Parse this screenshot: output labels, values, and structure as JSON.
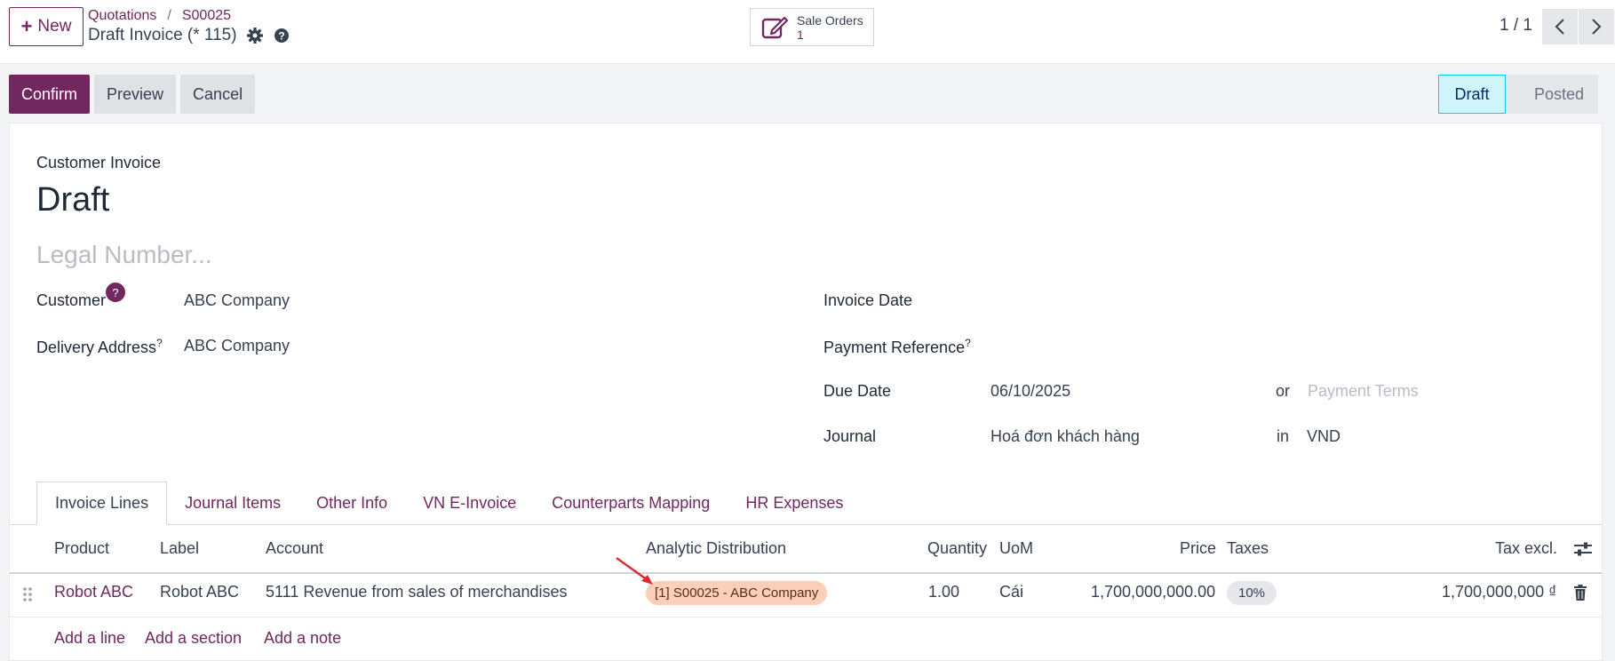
{
  "topbar": {
    "new_label": "New",
    "breadcrumb": [
      "Quotations",
      "S00025"
    ],
    "breadcrumb_sep": "/",
    "record_title": "Draft Invoice (* 115)",
    "smart_button": {
      "label": "Sale Orders",
      "value": "1"
    },
    "pager": "1 / 1"
  },
  "actions": {
    "confirm": "Confirm",
    "preview": "Preview",
    "cancel": "Cancel"
  },
  "status": {
    "current": "Draft",
    "next": "Posted"
  },
  "form": {
    "subtitle": "Customer Invoice",
    "title": "Draft",
    "legal_placeholder": "Legal Number...",
    "customer_label": "Customer",
    "customer_help": "?",
    "customer_value": "ABC Company",
    "delivery_label": "Delivery Address",
    "delivery_help": "?",
    "delivery_value": "ABC Company",
    "invoice_date_label": "Invoice Date",
    "payment_ref_label": "Payment Reference",
    "payment_ref_help": "?",
    "due_date_label": "Due Date",
    "due_date_value": "06/10/2025",
    "or_label": "or",
    "payment_terms_placeholder": "Payment Terms",
    "journal_label": "Journal",
    "journal_value": "Hoá đơn khách hàng",
    "in_label": "in",
    "currency_value": "VND"
  },
  "tabs": [
    "Invoice Lines",
    "Journal Items",
    "Other Info",
    "VN E-Invoice",
    "Counterparts Mapping",
    "HR Expenses"
  ],
  "table": {
    "headers": [
      "Product",
      "Label",
      "Account",
      "Analytic Distribution",
      "Quantity",
      "UoM",
      "Price",
      "Taxes",
      "Tax excl."
    ],
    "row": {
      "product": "Robot ABC",
      "label": "Robot ABC",
      "account": "5111 Revenue from sales of merchandises",
      "analytic": "[1] S00025 - ABC Company",
      "quantity": "1.00",
      "uom": "Cái",
      "price": "1,700,000,000.00",
      "tax": "10%",
      "subtotal": "1,700,000,000 ₫"
    },
    "add_line": "Add a line",
    "add_section": "Add a section",
    "add_note": "Add a note"
  },
  "colors": {
    "brand": "#71285e",
    "status_active": "#cff4fc",
    "analytic_tag": "#fbcfb8",
    "annotation_arrow": "#e0282e"
  }
}
